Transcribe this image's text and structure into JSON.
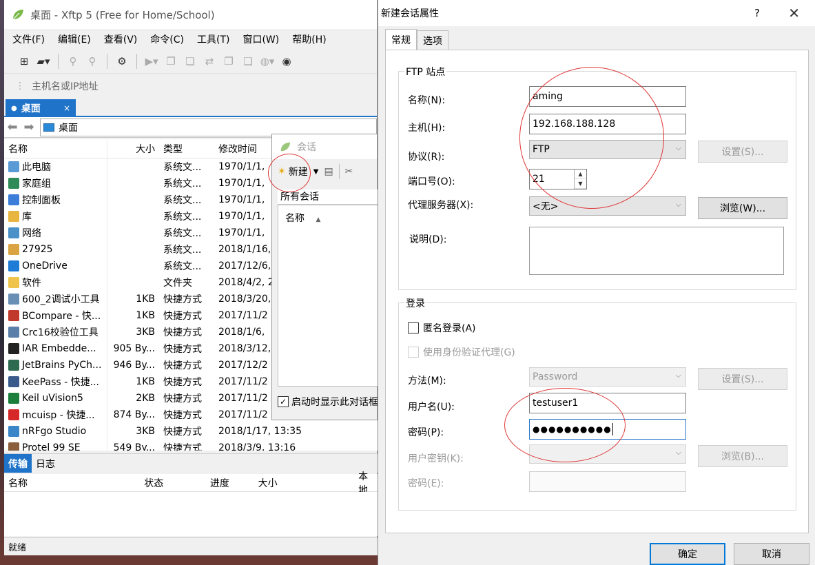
{
  "xftp": {
    "title": "桌面 - Xftp 5 (Free for Home/School)",
    "menu": [
      "文件(F)",
      "编辑(E)",
      "查看(V)",
      "命令(C)",
      "工具(T)",
      "窗口(W)",
      "帮助(H)"
    ],
    "address_placeholder": "主机名或IP地址",
    "tab_label": "桌面",
    "tab_close": "×",
    "path": "桌面",
    "columns": [
      "名称",
      "大小",
      "类型",
      "修改时间"
    ],
    "files": [
      {
        "name": "此电脑",
        "size": "",
        "type": "系统文...",
        "modified": "1970/1/1,",
        "icon": "computer-icon",
        "color": "#5b9bd5"
      },
      {
        "name": "家庭组",
        "size": "",
        "type": "系统文...",
        "modified": "1970/1/1,",
        "icon": "homegroup-icon",
        "color": "#2e8b57"
      },
      {
        "name": "控制面板",
        "size": "",
        "type": "系统文...",
        "modified": "1970/1/1,",
        "icon": "control-panel-icon",
        "color": "#3b7dd8"
      },
      {
        "name": "库",
        "size": "",
        "type": "系统文...",
        "modified": "1970/1/1,",
        "icon": "library-icon",
        "color": "#e8b640"
      },
      {
        "name": "网络",
        "size": "",
        "type": "系统文...",
        "modified": "1970/1/1,",
        "icon": "network-icon",
        "color": "#4a90c9"
      },
      {
        "name": "27925",
        "size": "",
        "type": "系统文...",
        "modified": "2018/1/16,",
        "icon": "user-folder-icon",
        "color": "#d9a441"
      },
      {
        "name": "OneDrive",
        "size": "",
        "type": "系统文...",
        "modified": "2017/12/6,",
        "icon": "onedrive-icon",
        "color": "#1e7bd6"
      },
      {
        "name": "软件",
        "size": "",
        "type": "文件夹",
        "modified": "2018/4/2, 2",
        "icon": "folder-icon",
        "color": "#f0c44c"
      },
      {
        "name": "600_2调试小工具",
        "size": "1KB",
        "type": "快捷方式",
        "modified": "2018/3/20,",
        "icon": "tool-shortcut-icon",
        "color": "#6a8fb5"
      },
      {
        "name": "BCompare - 快...",
        "size": "1KB",
        "type": "快捷方式",
        "modified": "2017/11/2",
        "icon": "bcompare-icon",
        "color": "#c0392b"
      },
      {
        "name": "Crc16校验位工具",
        "size": "3KB",
        "type": "快捷方式",
        "modified": "2018/1/6,",
        "icon": "crc-tool-icon",
        "color": "#5a7fa8"
      },
      {
        "name": "IAR Embedde...",
        "size": "905 By...",
        "type": "快捷方式",
        "modified": "2018/3/12,",
        "icon": "iar-icon",
        "color": "#222222"
      },
      {
        "name": "JetBrains PyCh...",
        "size": "946 By...",
        "type": "快捷方式",
        "modified": "2017/12/2",
        "icon": "pycharm-icon",
        "color": "#2d6a4f"
      },
      {
        "name": "KeePass - 快捷...",
        "size": "1KB",
        "type": "快捷方式",
        "modified": "2017/11/2",
        "icon": "keepass-icon",
        "color": "#3a5a8c"
      },
      {
        "name": "Keil uVision5",
        "size": "2KB",
        "type": "快捷方式",
        "modified": "2017/11/2",
        "icon": "keil-icon",
        "color": "#1b7f3b"
      },
      {
        "name": "mcuisp - 快捷...",
        "size": "874 By...",
        "type": "快捷方式",
        "modified": "2017/11/2",
        "icon": "mcuisp-icon",
        "color": "#d62828"
      },
      {
        "name": "nRFgo Studio",
        "size": "3KB",
        "type": "快捷方式",
        "modified": "2018/1/17, 13:35",
        "icon": "nrfgo-icon",
        "color": "#3a86c8"
      },
      {
        "name": "Protel 99 SE",
        "size": "549 By...",
        "type": "快捷方式",
        "modified": "2018/3/9, 13:16",
        "icon": "protel-icon",
        "color": "#8b5e3c"
      }
    ],
    "lower_tabs": [
      "传输",
      "日志"
    ],
    "transfer_columns": [
      "名称",
      "状态",
      "进度",
      "大小",
      "本地"
    ],
    "status": "就绪"
  },
  "session": {
    "title": "会话",
    "new_label": "新建",
    "all_sessions": "所有会话",
    "col_name": "名称",
    "startup_label": "启动时显示此对话框"
  },
  "props": {
    "title": "新建会话属性",
    "help": "?",
    "close": "✕",
    "tabs": [
      "常规",
      "选项"
    ],
    "ftp_group": "FTP 站点",
    "name_label": "名称(N):",
    "name_value": "aming",
    "host_label": "主机(H):",
    "host_value": "192.168.188.128",
    "protocol_label": "协议(R):",
    "protocol_value": "FTP",
    "protocol_settings": "设置(S)...",
    "port_label": "端口号(O):",
    "port_value": "21",
    "proxy_label": "代理服务器(X):",
    "proxy_value": "<无>",
    "proxy_browse": "浏览(W)...",
    "desc_label": "说明(D):",
    "login_group": "登录",
    "anon_label": "匿名登录(A)",
    "agent_label": "使用身份验证代理(G)",
    "method_label": "方法(M):",
    "method_value": "Password",
    "method_settings": "设置(S)...",
    "user_label": "用户名(U):",
    "user_value": "testuser1",
    "pass_label": "密码(P):",
    "pass_value": "●●●●●●●●●●",
    "userkey_label": "用户密钥(K):",
    "userkey_browse": "浏览(B)...",
    "passphrase_label": "密码(E):",
    "ok": "确定",
    "cancel": "取消"
  },
  "colors": {
    "accent": "#1f73c9",
    "annotation": "#e03535"
  }
}
